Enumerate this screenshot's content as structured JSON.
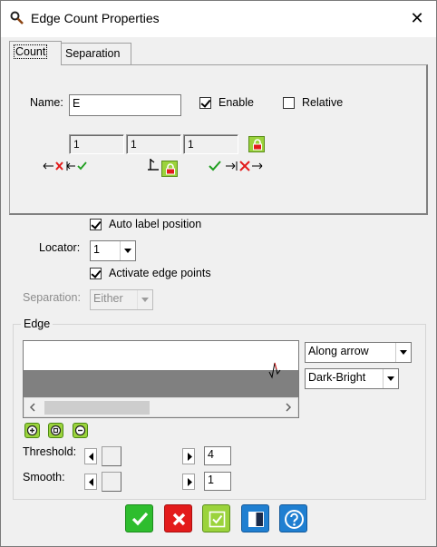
{
  "window": {
    "title": "Edge Count Properties",
    "close_symbol": "✕"
  },
  "tabs": [
    {
      "label": "Count",
      "active": true
    },
    {
      "label": "Separation",
      "active": false
    }
  ],
  "count_tab": {
    "name_label": "Name:",
    "name_value": "E",
    "enable_label": "Enable",
    "enable_checked": true,
    "relative_label": "Relative",
    "relative_checked": false,
    "spacing_values": [
      "1",
      "1",
      "1"
    ]
  },
  "options": {
    "auto_label_position": "Auto label position",
    "auto_label_checked": true,
    "locator_label": "Locator:",
    "locator_value": "1",
    "activate_edge_points": "Activate edge points",
    "activate_checked": true,
    "separation_label": "Separation:",
    "separation_value": "Either"
  },
  "edge": {
    "group_label": "Edge",
    "direction_value": "Along arrow",
    "polarity_value": "Dark-Bright",
    "threshold_label": "Threshold:",
    "threshold_value": "4",
    "smooth_label": "Smooth:",
    "smooth_value": "1"
  },
  "colors": {
    "accent_green": "#9bd33c",
    "ok": "#2ebd2e",
    "cancel": "#e31b1b",
    "help": "#1f7fd1",
    "dark_strip": "#808080"
  }
}
